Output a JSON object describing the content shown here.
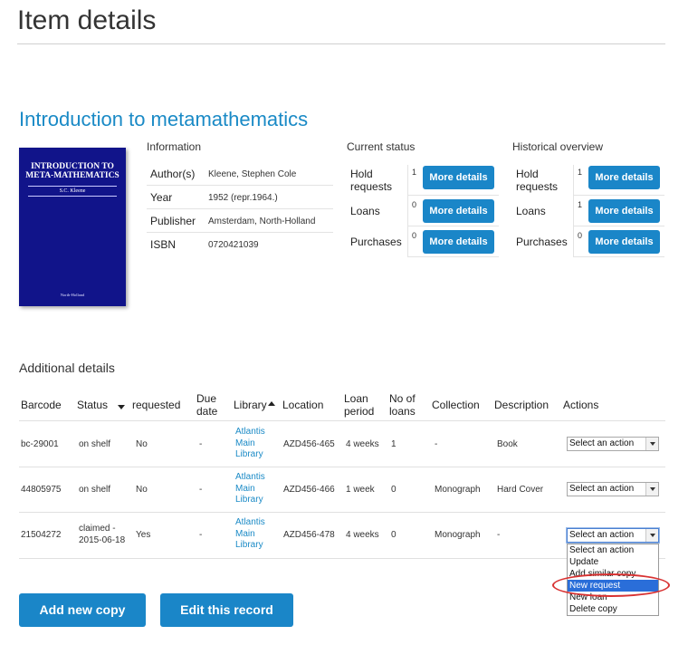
{
  "page": {
    "title": "Item details"
  },
  "book": {
    "title": "Introduction to metamathematics",
    "cover": {
      "title": "INTRODUCTION TO META-MATHEMATICS",
      "author": "S.C. Kleene",
      "publisher": "North-Holland",
      "color": "#11148a"
    }
  },
  "information": {
    "heading": "Information",
    "rows": [
      {
        "label": "Author(s)",
        "value": "Kleene, Stephen Cole"
      },
      {
        "label": "Year",
        "value": "1952 (repr.1964.)"
      },
      {
        "label": "Publisher",
        "value": "Amsterdam, North-Holland"
      },
      {
        "label": "ISBN",
        "value": "0720421039"
      }
    ]
  },
  "current_status": {
    "heading": "Current status",
    "rows": [
      {
        "label": "Hold requests",
        "count": "1",
        "button": "More details"
      },
      {
        "label": "Loans",
        "count": "0",
        "button": "More details"
      },
      {
        "label": "Purchases",
        "count": "0",
        "button": "More details"
      }
    ]
  },
  "historical": {
    "heading": "Historical overview",
    "rows": [
      {
        "label": "Hold requests",
        "count": "1",
        "button": "More details"
      },
      {
        "label": "Loans",
        "count": "1",
        "button": "More details"
      },
      {
        "label": "Purchases",
        "count": "0",
        "button": "More details"
      }
    ]
  },
  "additional": {
    "heading": "Additional details",
    "columns": [
      "Barcode",
      "Status",
      "requested",
      "Due date",
      "Library",
      "Location",
      "Loan period",
      "No of loans",
      "Collection",
      "Description",
      "Actions"
    ],
    "rows": [
      {
        "barcode": "bc-29001",
        "status": "on shelf",
        "requested": "No",
        "due": "-",
        "library": "Atlantis Main Library",
        "location": "AZD456-465",
        "loan_period": "4 weeks",
        "loans": "1",
        "collection": "-",
        "description": "Book",
        "action": "Select an action"
      },
      {
        "barcode": "44805975",
        "status": "on shelf",
        "requested": "No",
        "due": "-",
        "library": "Atlantis Main Library",
        "location": "AZD456-466",
        "loan_period": "1 week",
        "loans": "0",
        "collection": "Monograph",
        "description": "Hard Cover",
        "action": "Select an action"
      },
      {
        "barcode": "21504272",
        "status": "claimed - 2015-06-18",
        "requested": "Yes",
        "due": "-",
        "library": "Atlantis Main Library",
        "location": "AZD456-478",
        "loan_period": "4 weeks",
        "loans": "0",
        "collection": "Monograph",
        "description": "-",
        "action": "Select an action"
      }
    ],
    "dropdown_options": [
      "Select an action",
      "Update",
      "Add similar copy",
      "New request",
      "New loan",
      "Delete copy"
    ],
    "dropdown_highlighted": "New request"
  },
  "buttons": {
    "add_copy": "Add new copy",
    "edit_record": "Edit this record"
  },
  "colors": {
    "accent": "#1a86c8",
    "link": "#1a8ac6",
    "highlight": "#d83232",
    "selected": "#2a6ed9"
  }
}
